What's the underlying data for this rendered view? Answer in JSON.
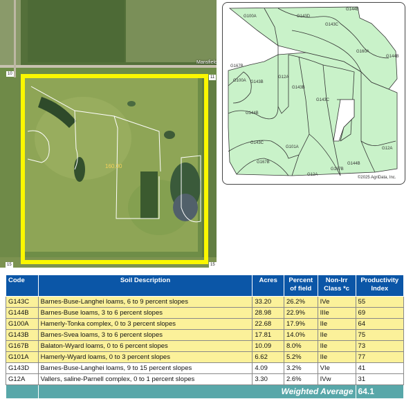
{
  "aerial": {
    "place_label": "Mansfield",
    "road_labels": [
      "10",
      "11",
      "15",
      "15"
    ],
    "field_acres": "160.00"
  },
  "soil_map": {
    "copyright": "©2025 AgriData, Inc.",
    "labels": [
      "G100A",
      "G143D",
      "G144B",
      "G143C",
      "G160A",
      "G144B",
      "G167B",
      "G100A",
      "G143B",
      "G12A",
      "G143B",
      "G143C",
      "G144B",
      "G143C",
      "G101A",
      "G167B",
      "G12A",
      "G144B",
      "G12A",
      "G167B"
    ]
  },
  "table": {
    "headers": [
      "Code",
      "Soil Description",
      "Acres",
      "Percent of field",
      "Non-Irr Class *c",
      "Productivity Index"
    ],
    "rows": [
      {
        "code": "G143C",
        "desc": "Barnes-Buse-Langhei loams, 6 to 9 percent slopes",
        "acres": "33.20",
        "pct": "26.2%",
        "cls": "IVe",
        "prod": "55",
        "highlight": true
      },
      {
        "code": "G144B",
        "desc": "Barnes-Buse loams, 3 to 6 percent slopes",
        "acres": "28.98",
        "pct": "22.9%",
        "cls": "IIIe",
        "prod": "69",
        "highlight": true
      },
      {
        "code": "G100A",
        "desc": "Hamerly-Tonka complex, 0 to 3 percent slopes",
        "acres": "22.68",
        "pct": "17.9%",
        "cls": "IIe",
        "prod": "64",
        "highlight": true
      },
      {
        "code": "G143B",
        "desc": "Barnes-Svea loams, 3 to 6 percent slopes",
        "acres": "17.81",
        "pct": "14.0%",
        "cls": "IIe",
        "prod": "75",
        "highlight": true
      },
      {
        "code": "G167B",
        "desc": "Balaton-Wyard loams, 0 to 6 percent slopes",
        "acres": "10.09",
        "pct": "8.0%",
        "cls": "IIe",
        "prod": "73",
        "highlight": true
      },
      {
        "code": "G101A",
        "desc": "Hamerly-Wyard loams, 0 to 3 percent slopes",
        "acres": "6.62",
        "pct": "5.2%",
        "cls": "IIe",
        "prod": "77",
        "highlight": true
      },
      {
        "code": "G143D",
        "desc": "Barnes-Buse-Langhei loams, 9 to 15 percent slopes",
        "acres": "4.09",
        "pct": "3.2%",
        "cls": "VIe",
        "prod": "41",
        "highlight": false
      },
      {
        "code": "G12A",
        "desc": "Vallers, saline-Parnell complex, 0 to 1 percent slopes",
        "acres": "3.30",
        "pct": "2.6%",
        "cls": "IVw",
        "prod": "31",
        "highlight": false
      }
    ],
    "weighted_label": "Weighted Average",
    "weighted_value": "64.1"
  },
  "colors": {
    "header_blue": "#0b56a7",
    "highlight_yellow": "#fbf19a",
    "total_teal": "#58a7a9",
    "field_outline": "#fbf700",
    "soil_fill": "#c9f2c9"
  }
}
